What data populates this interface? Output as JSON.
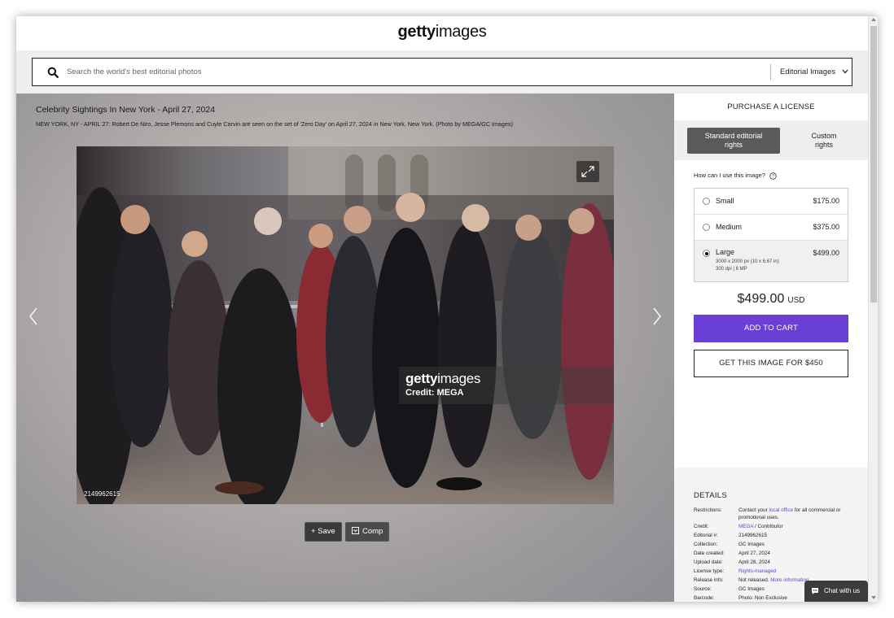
{
  "header": {
    "logo_bold": "getty",
    "logo_light": "images"
  },
  "search": {
    "placeholder": "Search the world's best editorial photos",
    "filter_label": "Editorial Images",
    "icon": "search-icon"
  },
  "main": {
    "title": "Celebrity Sightings In New York - April 27, 2024",
    "caption": "NEW YORK, NY - APRIL 27: Robert De Niro, Jesse Plemons and Cuyle Carvin are seen on the set of 'Zero Day' on April 27, 2024 in New York, New York. (Photo by MEGA/GC Images)",
    "photo_id": "2149962615",
    "watermark_bold": "getty",
    "watermark_light": "images",
    "watermark_credit": "Credit: MEGA",
    "save_label": "+ Save",
    "comp_label": "Comp"
  },
  "license": {
    "heading": "PURCHASE A LICENSE",
    "tab_standard_line1": "Standard editorial",
    "tab_standard_line2": "rights",
    "tab_custom_line1": "Custom",
    "tab_custom_line2": "rights",
    "usage_question": "How can I use this image?",
    "sizes": [
      {
        "name": "Small",
        "price": "$175.00",
        "selected": false
      },
      {
        "name": "Medium",
        "price": "$375.00",
        "selected": false
      },
      {
        "name": "Large",
        "price": "$499.00",
        "selected": true,
        "detail1": "3000 x 2000 px (10 x 6.67 in)",
        "detail2": "300 dpi | 6 MP"
      }
    ],
    "total": "$499.00",
    "currency": "USD",
    "add_to_cart": "ADD TO CART",
    "get_image": "GET THIS IMAGE FOR $450"
  },
  "details": {
    "heading": "DETAILS",
    "restrictions_label": "Restrictions:",
    "restrictions_pre": "Contact your ",
    "restrictions_link": "local office",
    "restrictions_post": " for all commercial or promotional uses.",
    "credit_label": "Credit:",
    "credit_link": "MEGA",
    "credit_post": " / Contributor",
    "editorial_label": "Editorial #:",
    "editorial_value": "2149962615",
    "collection_label": "Collection:",
    "collection_value": "GC Images",
    "date_created_label": "Date created:",
    "date_created_value": "April 27, 2024",
    "upload_label": "Upload date:",
    "upload_value": "April 28, 2024",
    "license_type_label": "License type:",
    "license_type_value": "Rights-managed",
    "release_label": "Release info:",
    "release_pre": "Not released. ",
    "release_link": "More information",
    "source_label": "Source:",
    "source_value": "GC Images",
    "barcode_label": "Barcode:",
    "barcode_value": "Photo: Non Exclusive"
  },
  "chat": {
    "label": "Chat with us"
  },
  "colors": {
    "accent": "#6a3fd6",
    "dark_button": "#3a3a3a"
  }
}
